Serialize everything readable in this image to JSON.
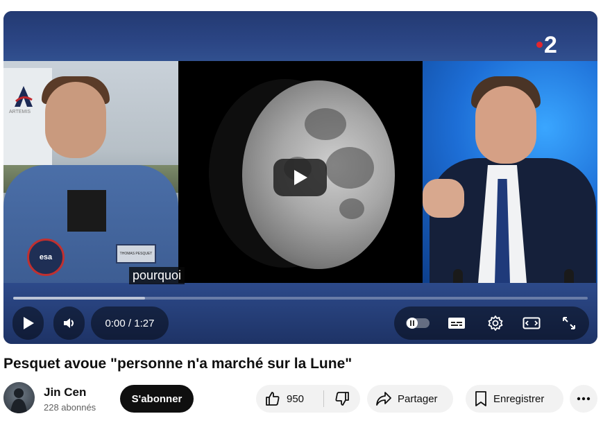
{
  "player": {
    "channel_logo": "2",
    "caption": "pourquoi",
    "logo_text": "ARTEMIS",
    "patch_text": "esa",
    "name_tag": "THOMAS PESQUET",
    "time": "0:00 / 1:27",
    "play_icon": "play-icon",
    "progress_buffered_fraction": 0.23,
    "progress_played_fraction": 0.0
  },
  "video": {
    "title": "Pesquet avoue \"personne n'a marché sur la Lune\""
  },
  "channel": {
    "name": "Jin Cen",
    "subscribers": "228 abonnés",
    "subscribe_label": "S'abonner"
  },
  "actions": {
    "likes": "950",
    "share_label": "Partager",
    "save_label": "Enregistrer"
  },
  "colors": {
    "accent_red": "#e3262e",
    "subscribe_bg": "#0f0f0f",
    "pill_bg": "#f2f2f2"
  }
}
